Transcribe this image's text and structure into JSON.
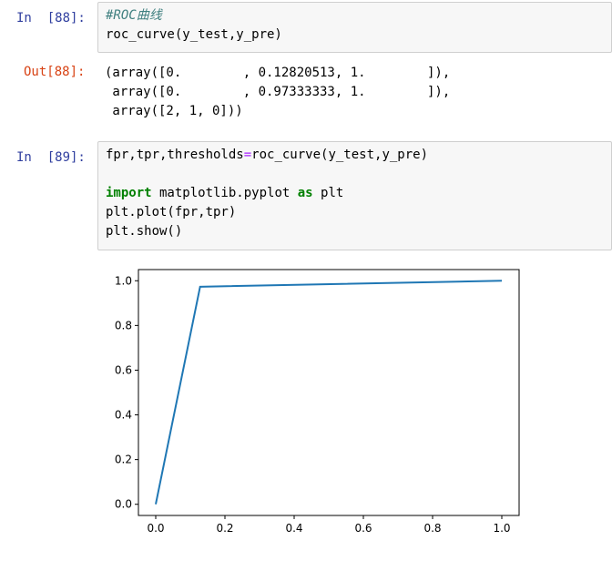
{
  "cells": [
    {
      "in_prompt": "In  [88]:",
      "code_lines": [
        [
          {
            "t": "#ROC曲线",
            "c": "comment"
          }
        ],
        [
          {
            "t": "roc_curve(y_test,y_pre)",
            "c": ""
          }
        ]
      ],
      "out_prompt": "Out[88]:",
      "output_lines": [
        "(array([0.        , 0.12820513, 1.        ]),",
        " array([0.        , 0.97333333, 1.        ]),",
        " array([2, 1, 0]))"
      ]
    },
    {
      "in_prompt": "In  [89]:",
      "code_lines": [
        [
          {
            "t": "fpr,tpr,thresholds",
            "c": ""
          },
          {
            "t": "=",
            "c": "op"
          },
          {
            "t": "roc_curve(y_test,y_pre)",
            "c": ""
          }
        ],
        [],
        [
          {
            "t": "import",
            "c": "kw"
          },
          {
            "t": " matplotlib.pyplot ",
            "c": ""
          },
          {
            "t": "as",
            "c": "kw"
          },
          {
            "t": " plt",
            "c": ""
          }
        ],
        [
          {
            "t": "plt.plot(fpr,tpr)",
            "c": ""
          }
        ],
        [
          {
            "t": "plt.show()",
            "c": ""
          }
        ]
      ]
    }
  ],
  "chart_data": {
    "type": "line",
    "title": "",
    "xlabel": "",
    "ylabel": "",
    "xlim": [
      -0.05,
      1.05
    ],
    "ylim": [
      -0.05,
      1.05
    ],
    "xticks": [
      "0.0",
      "0.2",
      "0.4",
      "0.6",
      "0.8",
      "1.0"
    ],
    "yticks": [
      "0.0",
      "0.2",
      "0.4",
      "0.6",
      "0.8",
      "1.0"
    ],
    "grid": false,
    "line_color": "#1f77b4",
    "series": [
      {
        "x": [
          0.0,
          0.12820513,
          1.0
        ],
        "y": [
          0.0,
          0.97333333,
          1.0
        ]
      }
    ]
  }
}
